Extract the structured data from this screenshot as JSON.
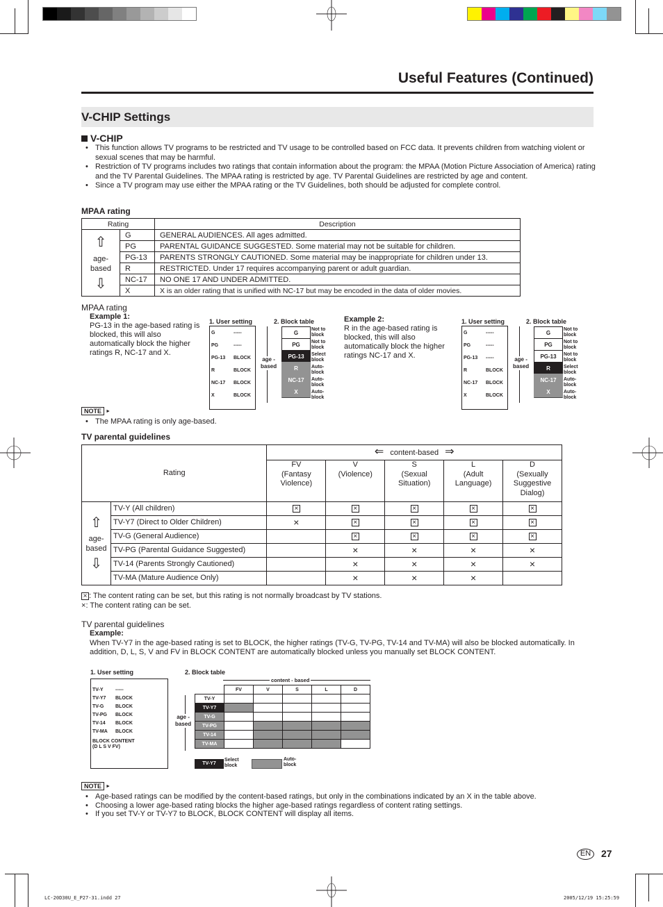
{
  "print_marks": {
    "gray_swatches": [
      "#000000",
      "#1a1a1a",
      "#333333",
      "#4d4d4d",
      "#666666",
      "#808080",
      "#999999",
      "#b3b3b3",
      "#cccccc",
      "#e6e6e6",
      "#ffffff"
    ],
    "color_swatches": [
      "#fff200",
      "#ec008c",
      "#00aeef",
      "#2e3192",
      "#00a651",
      "#ed1c24",
      "#231f20",
      "#fff685",
      "#f287c4",
      "#7dd8f7",
      "#939393"
    ],
    "footer_left": "LC-20D30U_E_P27-31.indd   27",
    "footer_right": "2005/12/19   15:25:59"
  },
  "header": {
    "title": "Useful Features (Continued)",
    "section": "V-CHIP Settings"
  },
  "vchip": {
    "heading": "V-CHIP",
    "bullets": [
      "This function allows TV programs to be restricted and TV usage to be controlled based on FCC data. It prevents children from watching violent or sexual scenes that may be harmful.",
      "Restriction of TV programs includes two ratings that contain information about the program: the MPAA (Motion Picture Association of America) rating and the TV Parental Guidelines. The MPAA rating is restricted by age. TV Parental Guidelines are restricted by age and content.",
      "Since a TV program may use either the MPAA rating or the TV Guidelines, both should be adjusted for complete control."
    ]
  },
  "mpaa": {
    "heading": "MPAA rating",
    "col_rating": "Rating",
    "col_description": "Description",
    "age_label_1": "age-",
    "age_label_2": "based",
    "arrow_up": "⇧",
    "arrow_down": "⇩",
    "rows": [
      {
        "rating": "G",
        "description": "GENERAL AUDIENCES. All ages admitted."
      },
      {
        "rating": "PG",
        "description": "PARENTAL GUIDANCE SUGGESTED. Some material may not be suitable for children."
      },
      {
        "rating": "PG-13",
        "description": "PARENTS STRONGLY CAUTIONED.  Some material may be inappropriate for children under 13."
      },
      {
        "rating": "R",
        "description": "RESTRICTED. Under 17 requires accompanying parent or adult guardian."
      },
      {
        "rating": "NC-17",
        "description": "NO ONE 17 AND UNDER ADMITTED."
      },
      {
        "rating": "X",
        "description": "X is an older rating that is unified with NC-17 but may be encoded in the data of older movies."
      }
    ]
  },
  "mpaa_examples": {
    "heading": "MPAA rating",
    "user_setting_label": "1. User setting",
    "block_table_label": "2. Block table",
    "age_based_1": "age -",
    "age_based_2": "based",
    "example1": {
      "title": "Example 1:",
      "text": "PG-13 in the age-based rating is blocked, this will also automatically block the higher ratings R, NC-17 and X.",
      "user_rows": [
        [
          "G",
          "-----"
        ],
        [
          "PG",
          "-----"
        ],
        [
          "PG-13",
          "BLOCK"
        ],
        [
          "R",
          "BLOCK"
        ],
        [
          "NC-17",
          "BLOCK"
        ],
        [
          "X",
          "BLOCK"
        ]
      ],
      "block_rows": [
        {
          "label": "G",
          "state": "Not to block"
        },
        {
          "label": "PG",
          "state": "Not to block"
        },
        {
          "label": "PG-13",
          "state": "Select block"
        },
        {
          "label": "R",
          "state": "Auto-block"
        },
        {
          "label": "NC-17",
          "state": "Auto-block"
        },
        {
          "label": "X",
          "state": "Auto-block"
        }
      ]
    },
    "example2": {
      "title": "Example 2:",
      "text": "R in the age-based rating is blocked, this will also automatically block the higher ratings NC-17 and X.",
      "user_rows": [
        [
          "G",
          "-----"
        ],
        [
          "PG",
          "-----"
        ],
        [
          "PG-13",
          "-----"
        ],
        [
          "R",
          "BLOCK"
        ],
        [
          "NC-17",
          "BLOCK"
        ],
        [
          "X",
          "BLOCK"
        ]
      ],
      "block_rows": [
        {
          "label": "G",
          "state": "Not to block"
        },
        {
          "label": "PG",
          "state": "Not to block"
        },
        {
          "label": "PG-13",
          "state": "Not to block"
        },
        {
          "label": "R",
          "state": "Select block"
        },
        {
          "label": "NC-17",
          "state": "Auto-block"
        },
        {
          "label": "X",
          "state": "Auto-block"
        }
      ]
    }
  },
  "note1": {
    "badge": "NOTE",
    "items": [
      "The MPAA rating is only age-based."
    ]
  },
  "tv": {
    "heading": "TV parental guidelines",
    "content_based": "content-based",
    "rating_header": "Rating",
    "age_label_1": "age-",
    "age_label_2": "based",
    "columns": [
      {
        "code": "FV",
        "desc": "(Fantasy Violence)"
      },
      {
        "code": "V",
        "desc": "(Violence)"
      },
      {
        "code": "S",
        "desc": "(Sexual Situation)"
      },
      {
        "code": "L",
        "desc": "(Adult Language)"
      },
      {
        "code": "D",
        "desc": "(Sexually Suggestive Dialog)"
      }
    ],
    "rows": [
      {
        "name": "TV-Y (All children)",
        "cells": [
          "box",
          "box",
          "box",
          "box",
          "box"
        ]
      },
      {
        "name": "TV-Y7 (Direct to Older Children)",
        "cells": [
          "x",
          "box",
          "box",
          "box",
          "box"
        ]
      },
      {
        "name": "TV-G (General Audience)",
        "cells": [
          "",
          "box",
          "box",
          "box",
          "box"
        ]
      },
      {
        "name": "TV-PG (Parental Guidance Suggested)",
        "cells": [
          "",
          "x",
          "x",
          "x",
          "x"
        ]
      },
      {
        "name": "TV-14 (Parents Strongly Cautioned)",
        "cells": [
          "",
          "x",
          "x",
          "x",
          "x"
        ]
      },
      {
        "name": "TV-MA (Mature Audience Only)",
        "cells": [
          "",
          "x",
          "x",
          "x",
          ""
        ]
      }
    ],
    "legend_box": ": The content rating can be set, but this rating is not normally broadcast by TV stations.",
    "legend_x": ": The content rating can be set."
  },
  "tv_example": {
    "heading": "TV parental guidelines",
    "title": "Example:",
    "text": "When TV-Y7 in the age-based rating is set to BLOCK, the higher ratings (TV-G, TV-PG, TV-14 and TV-MA) will also be blocked automatically. In addition, D, L, S, V and FV in BLOCK CONTENT are automatically blocked unless you manually set BLOCK CONTENT.",
    "user_setting_label": "1. User setting",
    "block_table_label": "2. Block table",
    "content_based": "content - based",
    "age_based_1": "age -",
    "age_based_2": "based",
    "user_rows": [
      [
        "TV-Y",
        "-----"
      ],
      [
        "TV-Y7",
        "BLOCK"
      ],
      [
        "TV-G",
        "BLOCK"
      ],
      [
        "TV-PG",
        "BLOCK"
      ],
      [
        "TV-14",
        "BLOCK"
      ],
      [
        "TV-MA",
        "BLOCK"
      ]
    ],
    "block_content_1": "BLOCK CONTENT",
    "block_content_2": "(D L S V FV)",
    "columns": [
      "FV",
      "V",
      "S",
      "L",
      "D"
    ],
    "rows": [
      {
        "label": "TV-Y",
        "style": "white",
        "cells": [
          0,
          0,
          0,
          0,
          0
        ]
      },
      {
        "label": "TV-Y7",
        "style": "black",
        "cells": [
          1,
          0,
          0,
          0,
          0
        ]
      },
      {
        "label": "TV-G",
        "style": "gray",
        "cells": [
          0,
          0,
          0,
          0,
          0
        ]
      },
      {
        "label": "TV-PG",
        "style": "gray",
        "cells": [
          0,
          1,
          1,
          1,
          1
        ]
      },
      {
        "label": "TV-14",
        "style": "gray",
        "cells": [
          0,
          1,
          1,
          1,
          1
        ]
      },
      {
        "label": "TV-MA",
        "style": "gray",
        "cells": [
          0,
          1,
          1,
          1,
          0
        ]
      }
    ],
    "legend_select_label": "TV-Y7",
    "legend_select": "Select block",
    "legend_auto": "Auto-block"
  },
  "note2": {
    "badge": "NOTE",
    "items": [
      "Age-based ratings can be modified by the content-based ratings, but only in the combinations indicated by an X in the table above.",
      "Choosing a lower age-based rating blocks the higher age-based ratings regardless of content rating settings.",
      "If you set TV-Y or TV-Y7 to BLOCK, BLOCK CONTENT will display all items."
    ]
  },
  "page": {
    "lang_badge": "EN",
    "number": "27"
  }
}
